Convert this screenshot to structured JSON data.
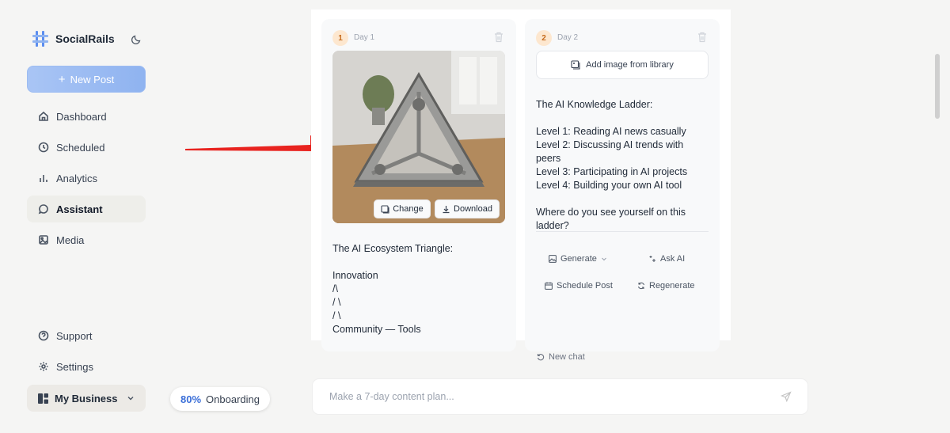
{
  "sidebar": {
    "brand": "SocialRails",
    "new_post": "New Post",
    "nav": {
      "dashboard": "Dashboard",
      "scheduled": "Scheduled",
      "analytics": "Analytics",
      "assistant": "Assistant",
      "media": "Media",
      "support": "Support",
      "settings": "Settings"
    },
    "business": "My Business"
  },
  "onboarding": {
    "percent": "80%",
    "label": "Onboarding"
  },
  "cards": [
    {
      "day_number": "1",
      "day_label": "Day 1",
      "change_label": "Change",
      "download_label": "Download",
      "text": "The AI Ecosystem Triangle:\n\nInnovation\n/\\\n/ \\\n/ \\\nCommunity — Tools"
    },
    {
      "day_number": "2",
      "day_label": "Day 2",
      "add_image_label": "Add image from library",
      "text": "The AI Knowledge Ladder:\n\nLevel 1: Reading AI news casually\nLevel 2: Discussing AI trends with peers\nLevel 3: Participating in AI projects\nLevel 4: Building your own AI tool\n\nWhere do you see yourself on this ladder?",
      "actions": {
        "generate": "Generate",
        "ask_ai": "Ask AI",
        "schedule": "Schedule Post",
        "regenerate": "Regenerate"
      }
    }
  ],
  "new_chat": "New chat",
  "composer": {
    "placeholder": "Make a 7-day content plan..."
  },
  "colors": {
    "accent": "#8fb3f0",
    "arrow": "#e8231f",
    "badge": "#fde7cf"
  }
}
